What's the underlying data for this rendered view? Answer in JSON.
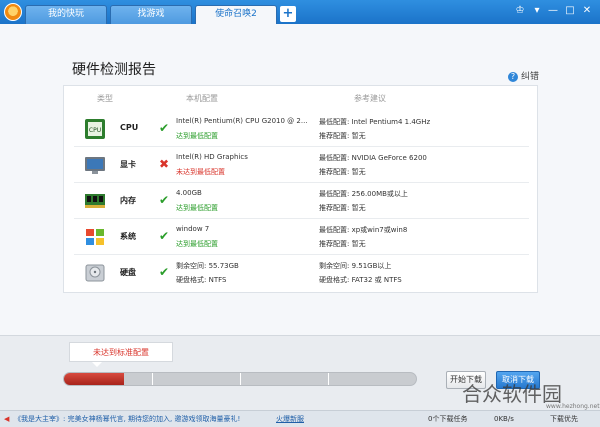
{
  "tabs": [
    {
      "label": "我的快玩"
    },
    {
      "label": "找游戏"
    },
    {
      "label": "使命召唤2"
    }
  ],
  "add_tab_label": "+",
  "window_buttons": {
    "skin": "♔",
    "menu": "▾",
    "minimize": "—",
    "maximize": "□",
    "close": "✕"
  },
  "report": {
    "title": "硬件检测报告",
    "correct_label": "纠错",
    "columns": {
      "type": "类型",
      "mine": "本机配置",
      "recommended": "参考建议"
    },
    "rows": [
      {
        "name": "CPU",
        "icon": "cpu-icon",
        "ok": true,
        "mine_1": "Intel(R) Pentium(R) CPU G2010 @ 2...",
        "mine_2": "达到最低配置",
        "min": "最低配置: Intel Pentium4 1.4GHz",
        "rec": "推荐配置: 暂无"
      },
      {
        "name": "显卡",
        "icon": "graphics-card-icon",
        "ok": false,
        "mine_1": "Intel(R) HD Graphics",
        "mine_2": "未达到最低配置",
        "min": "最低配置: NVIDIA GeForce 6200",
        "rec": "推荐配置: 暂无"
      },
      {
        "name": "内存",
        "icon": "memory-icon",
        "ok": true,
        "mine_1": "4.00GB",
        "mine_2": "达到最低配置",
        "min": "最低配置: 256.00MB或以上",
        "rec": "推荐配置: 暂无"
      },
      {
        "name": "系统",
        "icon": "windows-icon",
        "ok": true,
        "mine_1": "window 7",
        "mine_2": "达到最低配置",
        "min": "最低配置: xp或win7或win8",
        "rec": "推荐配置: 暂无"
      },
      {
        "name": "硬盘",
        "icon": "hard-disk-icon",
        "ok": true,
        "mine_1": "剩余空间: 55.73GB",
        "mine_2": "硬盘格式: NTFS",
        "min": "剩余空间: 9.51GB以上",
        "rec": "硬盘格式: FAT32 或 NTFS"
      }
    ]
  },
  "progress": {
    "tooltip": "未达到标准配置",
    "fraction": 0.17
  },
  "buttons": {
    "start": "开始下载",
    "cancel": "取消下载"
  },
  "statusbar": {
    "news": "《我是大主宰》: 完美女神杨幂代言, 期待您的加入, 邀游戏领取海量豪礼!",
    "link": "火爆新服",
    "downloads": "0个下载任务",
    "speed": "0KB/s",
    "extra": "下载优先"
  },
  "watermark": {
    "text": "合众软件园",
    "url": "www.hezhong.net"
  },
  "colors": {
    "accent": "#1b73c9",
    "ok": "#2a9d2a",
    "bad": "#d9342b"
  }
}
